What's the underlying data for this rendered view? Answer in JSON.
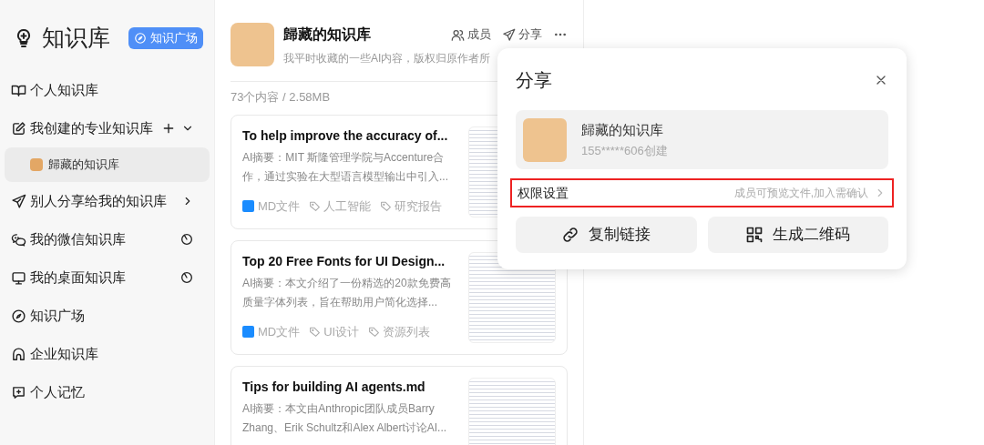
{
  "sidebar": {
    "title": "知识库",
    "plaza_button": "知识广场",
    "items": [
      {
        "kind": "link",
        "label": "个人知识库"
      },
      {
        "kind": "group",
        "label": "我创建的专业知识库",
        "add": true,
        "expanded": true,
        "children": [
          {
            "label": "歸藏的知识库",
            "selected": true
          }
        ]
      },
      {
        "kind": "group",
        "label": "别人分享给我的知识库",
        "add": false,
        "expanded": false
      },
      {
        "kind": "sync",
        "label": "我的微信知识库"
      },
      {
        "kind": "sync",
        "label": "我的桌面知识库"
      },
      {
        "kind": "link",
        "label": "知识广场"
      },
      {
        "kind": "link",
        "label": "企业知识库"
      },
      {
        "kind": "link",
        "label": "个人记忆"
      }
    ]
  },
  "library": {
    "title": "歸藏的知识库",
    "description": "我平时收藏的一些AI内容，版权归原作者所",
    "actions": [
      "成员",
      "分享"
    ],
    "stats": "73个内容 / 2.58MB"
  },
  "documents": [
    {
      "title": "To help improve the accuracy of...",
      "summary": "AI摘要：MIT 斯隆管理学院与Accenture合作，通过实验在大型语言模型输出中引入...",
      "type": "MD文件",
      "tags": [
        "人工智能",
        "研究报告"
      ]
    },
    {
      "title": "Top 20 Free Fonts for UI Design...",
      "summary": "AI摘要：本文介绍了一份精选的20款免费高质量字体列表，旨在帮助用户简化选择...",
      "type": "MD文件",
      "tags": [
        "UI设计",
        "资源列表"
      ]
    },
    {
      "title": "Tips for building AI agents.md",
      "summary": "AI摘要：本文由Anthropic团队成员Barry Zhang、Erik Schultz和Alex Albert讨论AI..."
    }
  ],
  "share_dialog": {
    "title": "分享",
    "library_name": "歸藏的知识库",
    "creator": "155*****606创建",
    "permission_label": "权限设置",
    "permission_value": "成员可预览文件,加入需确认",
    "permission_highlighted": true,
    "buttons": [
      {
        "kind": "link",
        "label": "复制链接"
      },
      {
        "kind": "qr",
        "label": "生成二维码"
      }
    ]
  }
}
